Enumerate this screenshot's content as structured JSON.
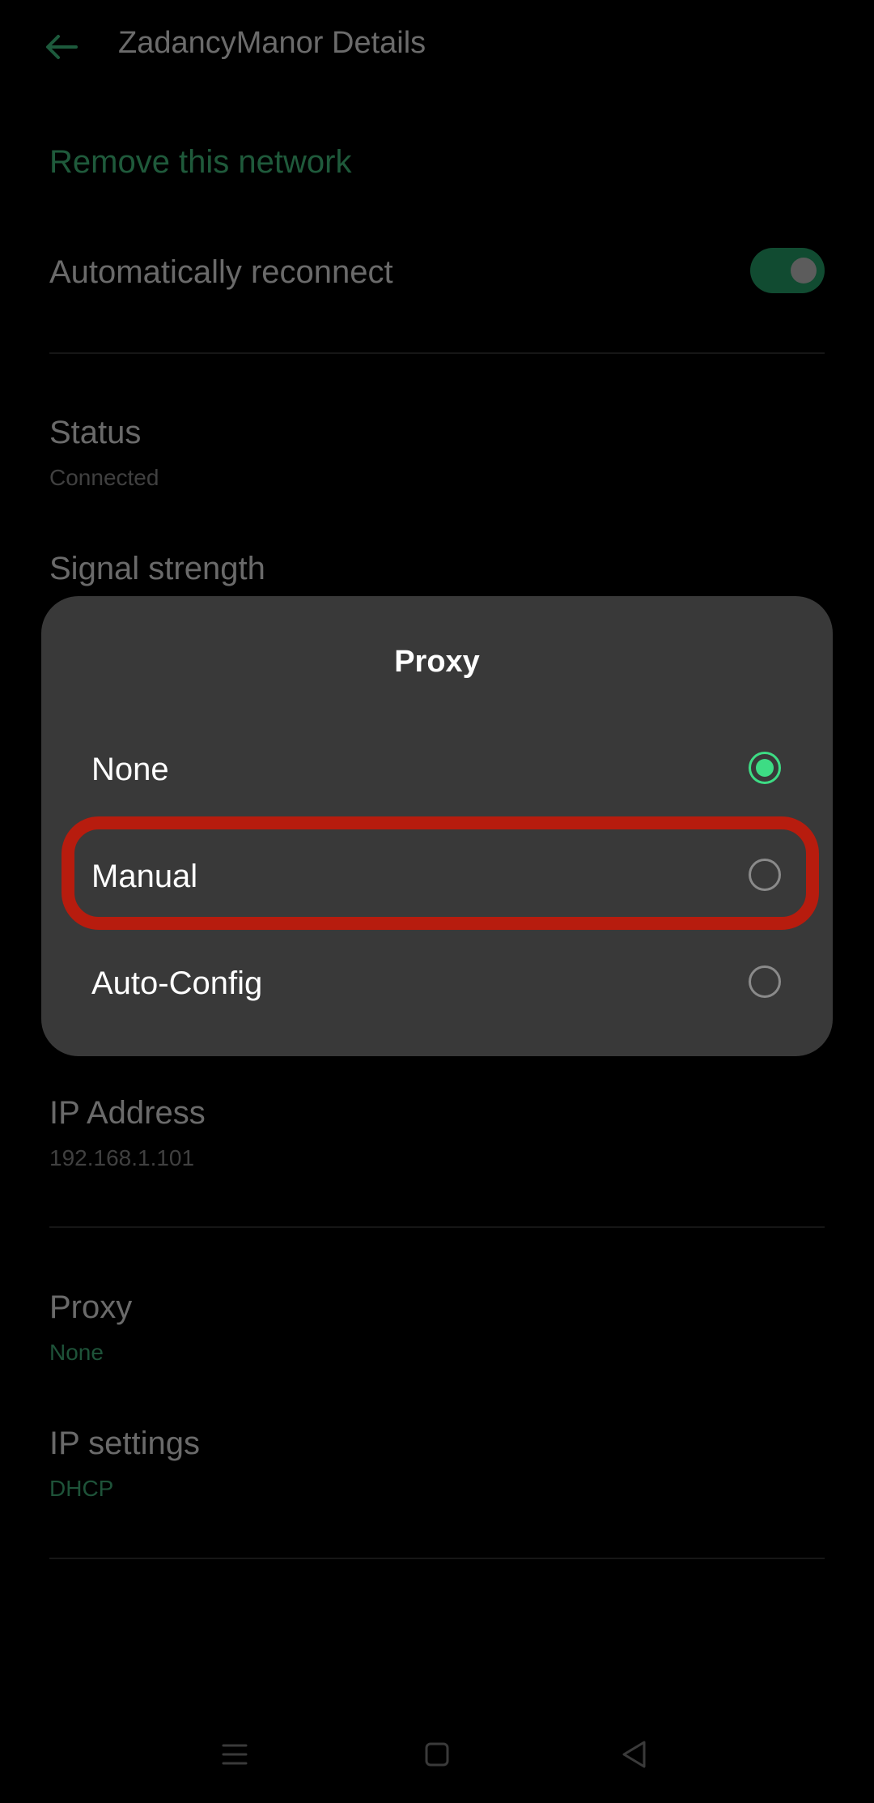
{
  "app_bar": {
    "title": "ZadancyManor Details",
    "back_icon": "arrow-left-icon"
  },
  "settings": {
    "remove_network": "Remove this network",
    "auto_reconnect": {
      "label": "Automatically reconnect",
      "enabled": true
    },
    "status": {
      "label": "Status",
      "value": "Connected"
    },
    "signal_strength": {
      "label": "Signal strength"
    },
    "ip_address": {
      "label": "IP Address",
      "value": "192.168.1.101"
    },
    "proxy": {
      "label": "Proxy",
      "value": "None"
    },
    "ip_settings": {
      "label": "IP settings",
      "value": "DHCP"
    }
  },
  "dialog": {
    "title": "Proxy",
    "options": [
      {
        "label": "None",
        "selected": true
      },
      {
        "label": "Manual",
        "selected": false
      },
      {
        "label": "Auto-Config",
        "selected": false
      }
    ],
    "highlighted_option": "Manual"
  },
  "colors": {
    "accent": "#3ddc84",
    "highlight": "#b71c0e",
    "dialog_bg": "#393939"
  },
  "nav_bar": {
    "icons": [
      "menu-icon",
      "home-square-icon",
      "back-triangle-icon"
    ]
  }
}
